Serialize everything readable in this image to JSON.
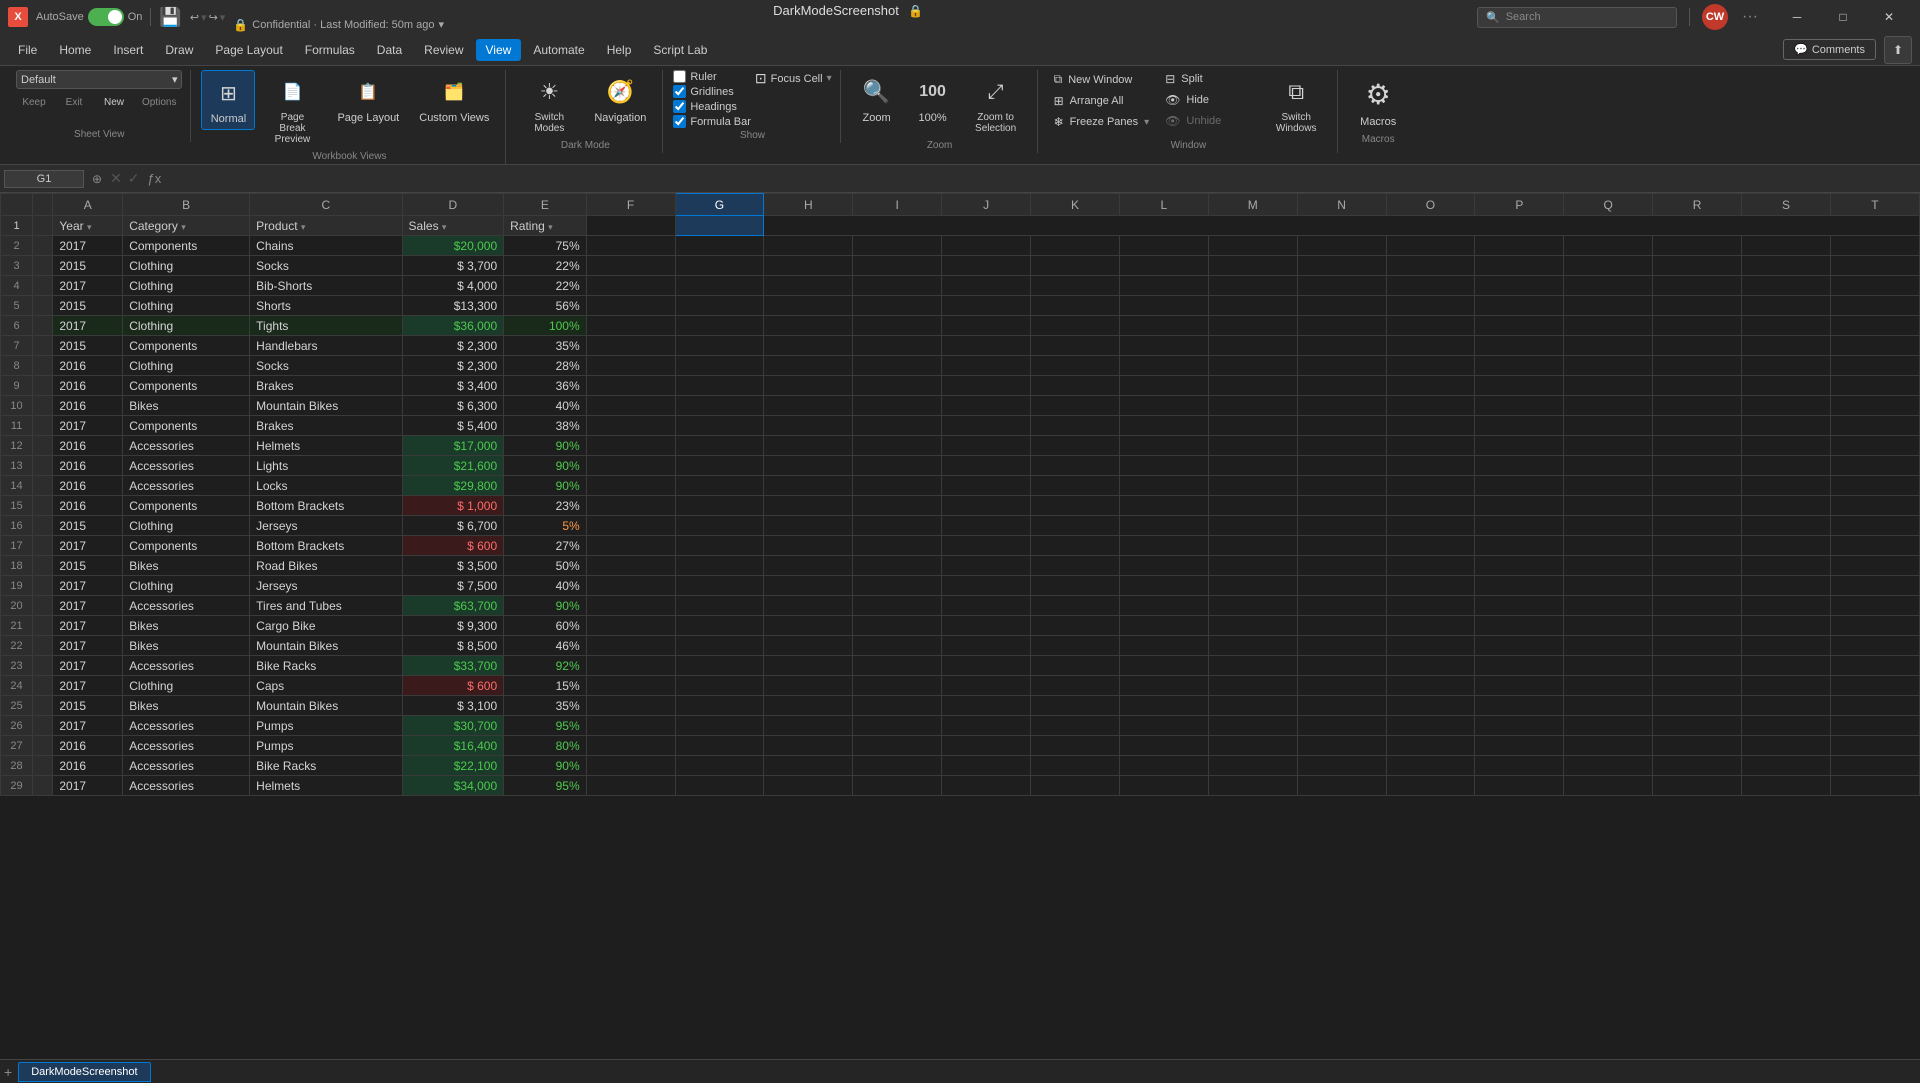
{
  "titleBar": {
    "logoText": "X",
    "autosave": "AutoSave",
    "toggleState": "On",
    "fileName": "DarkModeScreenshot",
    "confidential": "Confidential · Last Modified: 50m ago",
    "searchPlaceholder": "Search",
    "undoRedo": "↩ ↪",
    "userInitials": "CW"
  },
  "menuBar": {
    "items": [
      "File",
      "Home",
      "Insert",
      "Draw",
      "Page Layout",
      "Formulas",
      "Data",
      "Review",
      "View",
      "Automate",
      "Help",
      "Script Lab"
    ],
    "activeItem": "View",
    "comments": "Comments"
  },
  "ribbon": {
    "sheetView": {
      "label": "Sheet View",
      "dropdown": "Default",
      "buttons": [
        "Keep",
        "Exit",
        "New",
        "Options"
      ]
    },
    "workbookViews": {
      "label": "Workbook Views",
      "normal": "Normal",
      "pageBreak": "Page Break\nPreview",
      "pageLayout": "Page Layout",
      "customViews": "Custom Views"
    },
    "darkMode": {
      "label": "Dark Mode",
      "switchModes": "Switch\nModes",
      "navigation": "Navigation"
    },
    "show": {
      "label": "Show",
      "ruler": "Ruler",
      "gridlines": "Gridlines",
      "headings": "Headings",
      "formulaBar": "Formula Bar",
      "focusCell": "Focus Cell"
    },
    "zoom": {
      "label": "Zoom",
      "zoom": "Zoom",
      "percent100": "100%",
      "zoomToSelection": "Zoom to\nSelection"
    },
    "window": {
      "label": "Window",
      "newWindow": "New Window",
      "arrange": "Arrange All",
      "freezePanes": "Freeze Panes",
      "split": "Split",
      "hide": "Hide",
      "unhide": "Unhide",
      "switchWindows": "Switch\nWindows"
    },
    "macros": {
      "label": "Macros",
      "macros": "Macros"
    }
  },
  "formulaBar": {
    "cellRef": "G1",
    "formula": ""
  },
  "columns": [
    "",
    "A",
    "B",
    "C",
    "D",
    "E",
    "F",
    "G",
    "H",
    "I",
    "J",
    "K",
    "L",
    "M",
    "N",
    "O",
    "P",
    "Q",
    "R",
    "S",
    "T"
  ],
  "headers": [
    "Year",
    "Category",
    "Product",
    "Sales",
    "Rating"
  ],
  "rows": [
    {
      "num": 2,
      "year": "2017",
      "category": "Components",
      "product": "Chains",
      "sales": "$20,000",
      "rating": "75%",
      "salesColor": "green",
      "ratingColor": "normal"
    },
    {
      "num": 3,
      "year": "2015",
      "category": "Clothing",
      "product": "Socks",
      "sales": "$ 3,700",
      "rating": "22%",
      "salesColor": "normal",
      "ratingColor": "normal"
    },
    {
      "num": 4,
      "year": "2017",
      "category": "Clothing",
      "product": "Bib-Shorts",
      "sales": "$ 4,000",
      "rating": "22%",
      "salesColor": "normal",
      "ratingColor": "normal"
    },
    {
      "num": 5,
      "year": "2015",
      "category": "Clothing",
      "product": "Shorts",
      "sales": "$13,300",
      "rating": "56%",
      "salesColor": "normal",
      "ratingColor": "normal"
    },
    {
      "num": 6,
      "year": "2017",
      "category": "Clothing",
      "product": "Tights",
      "sales": "$36,000",
      "rating": "100%",
      "salesColor": "green",
      "ratingColor": "high",
      "specialRow": true
    },
    {
      "num": 7,
      "year": "2015",
      "category": "Components",
      "product": "Handlebars",
      "sales": "$ 2,300",
      "rating": "35%",
      "salesColor": "normal",
      "ratingColor": "normal"
    },
    {
      "num": 8,
      "year": "2016",
      "category": "Clothing",
      "product": "Socks",
      "sales": "$ 2,300",
      "rating": "28%",
      "salesColor": "normal",
      "ratingColor": "normal"
    },
    {
      "num": 9,
      "year": "2016",
      "category": "Components",
      "product": "Brakes",
      "sales": "$ 3,400",
      "rating": "36%",
      "salesColor": "normal",
      "ratingColor": "normal"
    },
    {
      "num": 10,
      "year": "2016",
      "category": "Bikes",
      "product": "Mountain Bikes",
      "sales": "$ 6,300",
      "rating": "40%",
      "salesColor": "normal",
      "ratingColor": "normal"
    },
    {
      "num": 11,
      "year": "2017",
      "category": "Components",
      "product": "Brakes",
      "sales": "$ 5,400",
      "rating": "38%",
      "salesColor": "normal",
      "ratingColor": "normal"
    },
    {
      "num": 12,
      "year": "2016",
      "category": "Accessories",
      "product": "Helmets",
      "sales": "$17,000",
      "rating": "90%",
      "salesColor": "green",
      "ratingColor": "high"
    },
    {
      "num": 13,
      "year": "2016",
      "category": "Accessories",
      "product": "Lights",
      "sales": "$21,600",
      "rating": "90%",
      "salesColor": "green",
      "ratingColor": "high"
    },
    {
      "num": 14,
      "year": "2016",
      "category": "Accessories",
      "product": "Locks",
      "sales": "$29,800",
      "rating": "90%",
      "salesColor": "green",
      "ratingColor": "high"
    },
    {
      "num": 15,
      "year": "2016",
      "category": "Components",
      "product": "Bottom Brackets",
      "sales": "$ 1,000",
      "rating": "23%",
      "salesColor": "red",
      "ratingColor": "normal"
    },
    {
      "num": 16,
      "year": "2015",
      "category": "Clothing",
      "product": "Jerseys",
      "sales": "$ 6,700",
      "rating": "5%",
      "salesColor": "normal",
      "ratingColor": "low"
    },
    {
      "num": 17,
      "year": "2017",
      "category": "Components",
      "product": "Bottom Brackets",
      "sales": "$ 600",
      "rating": "27%",
      "salesColor": "red",
      "ratingColor": "normal"
    },
    {
      "num": 18,
      "year": "2015",
      "category": "Bikes",
      "product": "Road Bikes",
      "sales": "$ 3,500",
      "rating": "50%",
      "salesColor": "normal",
      "ratingColor": "normal"
    },
    {
      "num": 19,
      "year": "2017",
      "category": "Clothing",
      "product": "Jerseys",
      "sales": "$ 7,500",
      "rating": "40%",
      "salesColor": "normal",
      "ratingColor": "normal"
    },
    {
      "num": 20,
      "year": "2017",
      "category": "Accessories",
      "product": "Tires and Tubes",
      "sales": "$63,700",
      "rating": "90%",
      "salesColor": "green",
      "ratingColor": "high"
    },
    {
      "num": 21,
      "year": "2017",
      "category": "Bikes",
      "product": "Cargo Bike",
      "sales": "$ 9,300",
      "rating": "60%",
      "salesColor": "normal",
      "ratingColor": "normal"
    },
    {
      "num": 22,
      "year": "2017",
      "category": "Bikes",
      "product": "Mountain Bikes",
      "sales": "$ 8,500",
      "rating": "46%",
      "salesColor": "normal",
      "ratingColor": "normal"
    },
    {
      "num": 23,
      "year": "2017",
      "category": "Accessories",
      "product": "Bike Racks",
      "sales": "$33,700",
      "rating": "92%",
      "salesColor": "green",
      "ratingColor": "high"
    },
    {
      "num": 24,
      "year": "2017",
      "category": "Clothing",
      "product": "Caps",
      "sales": "$ 600",
      "rating": "15%",
      "salesColor": "red",
      "ratingColor": "normal"
    },
    {
      "num": 25,
      "year": "2015",
      "category": "Bikes",
      "product": "Mountain Bikes",
      "sales": "$ 3,100",
      "rating": "35%",
      "salesColor": "normal",
      "ratingColor": "normal"
    },
    {
      "num": 26,
      "year": "2017",
      "category": "Accessories",
      "product": "Pumps",
      "sales": "$30,700",
      "rating": "95%",
      "salesColor": "green",
      "ratingColor": "high"
    },
    {
      "num": 27,
      "year": "2016",
      "category": "Accessories",
      "product": "Pumps",
      "sales": "$16,400",
      "rating": "80%",
      "salesColor": "green",
      "ratingColor": "high"
    },
    {
      "num": 28,
      "year": "2016",
      "category": "Accessories",
      "product": "Bike Racks",
      "sales": "$22,100",
      "rating": "90%",
      "salesColor": "green",
      "ratingColor": "high"
    },
    {
      "num": 29,
      "year": "2017",
      "category": "Accessories",
      "product": "Helmets",
      "sales": "$34,000",
      "rating": "95%",
      "salesColor": "green",
      "ratingColor": "high"
    }
  ],
  "sheetTab": "DarkModeScreenshot"
}
